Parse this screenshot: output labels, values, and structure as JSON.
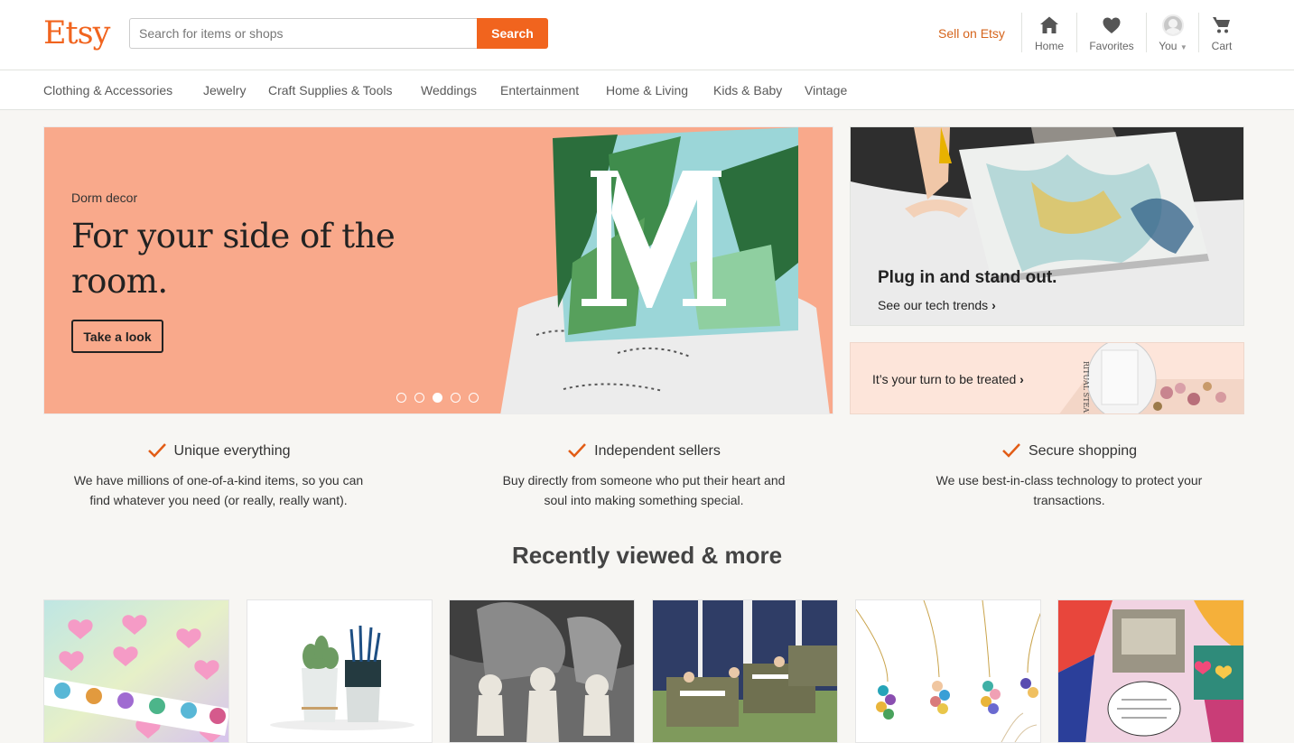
{
  "header": {
    "logo": "Etsy",
    "search": {
      "placeholder": "Search for items or shops",
      "value": ""
    },
    "search_button": "Search",
    "sell_link": "Sell on Etsy",
    "nav": {
      "home": {
        "label": "Home",
        "icon": "home-icon"
      },
      "favorites": {
        "label": "Favorites",
        "icon": "heart-icon"
      },
      "you": {
        "label": "You",
        "icon": "avatar"
      },
      "cart": {
        "label": "Cart",
        "icon": "cart-icon"
      }
    }
  },
  "categories": [
    "Clothing & Accessories",
    "Jewelry",
    "Craft Supplies & Tools",
    "Weddings",
    "Entertainment",
    "Home & Living",
    "Kids & Baby",
    "Vintage"
  ],
  "hero": {
    "kicker": "Dorm decor",
    "title": "For your side of the room.",
    "button": "Take a look",
    "slides_total": 5,
    "active_slide": 3
  },
  "promos": {
    "tech": {
      "title": "Plug in and stand out.",
      "link": "See our tech trends"
    },
    "treat": {
      "link": "It’s your turn to be treated"
    }
  },
  "value_props": [
    {
      "title": "Unique everything",
      "desc": "We have millions of one-of-a-kind items, so you can find whatever you need (or really, really want)."
    },
    {
      "title": "Independent sellers",
      "desc": "Buy directly from someone who put their heart and soul into making something special."
    },
    {
      "title": "Secure shopping",
      "desc": "We use best-in-class technology to protect your transactions."
    }
  ],
  "recently_viewed": {
    "title": "Recently viewed & more",
    "items": [
      "heart-stickers-image",
      "succulent-planter-image",
      "vintage-figurines-image",
      "ammo-box-image",
      "gem-necklace-image",
      "rainbow-pin-image"
    ]
  },
  "colors": {
    "brand": "#f1641e",
    "hero_bg": "#f9a98b",
    "check": "#e25c15"
  }
}
